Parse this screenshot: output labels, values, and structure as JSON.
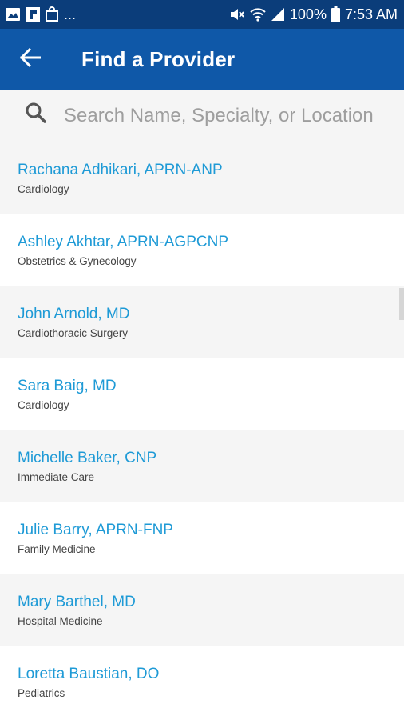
{
  "status_bar": {
    "battery_percent": "100%",
    "time": "7:53 AM",
    "more": "...",
    "left_icons": [
      "image-icon",
      "flipboard-icon",
      "bag-icon"
    ],
    "right_icons": [
      "mute-icon",
      "wifi-icon",
      "signal-icon",
      "battery-icon"
    ]
  },
  "app_bar": {
    "title": "Find a Provider",
    "back_icon": "arrow-left-icon",
    "color": "#0f58a8"
  },
  "search": {
    "placeholder": "Search Name, Specialty, or Location",
    "value": ""
  },
  "colors": {
    "status_bar": "#0b3d7a",
    "link": "#1e9ad6",
    "row_alt": "#f5f5f5"
  },
  "providers": [
    {
      "name": "Rachana Adhikari, APRN-ANP",
      "specialty": "Cardiology"
    },
    {
      "name": "Ashley Akhtar, APRN-AGPCNP",
      "specialty": "Obstetrics & Gynecology"
    },
    {
      "name": "John Arnold, MD",
      "specialty": "Cardiothoracic Surgery"
    },
    {
      "name": "Sara Baig, MD",
      "specialty": "Cardiology"
    },
    {
      "name": "Michelle Baker, CNP",
      "specialty": "Immediate Care"
    },
    {
      "name": "Julie Barry, APRN-FNP",
      "specialty": "Family Medicine"
    },
    {
      "name": "Mary Barthel, MD",
      "specialty": "Hospital Medicine"
    },
    {
      "name": "Loretta Baustian, DO",
      "specialty": "Pediatrics"
    }
  ]
}
